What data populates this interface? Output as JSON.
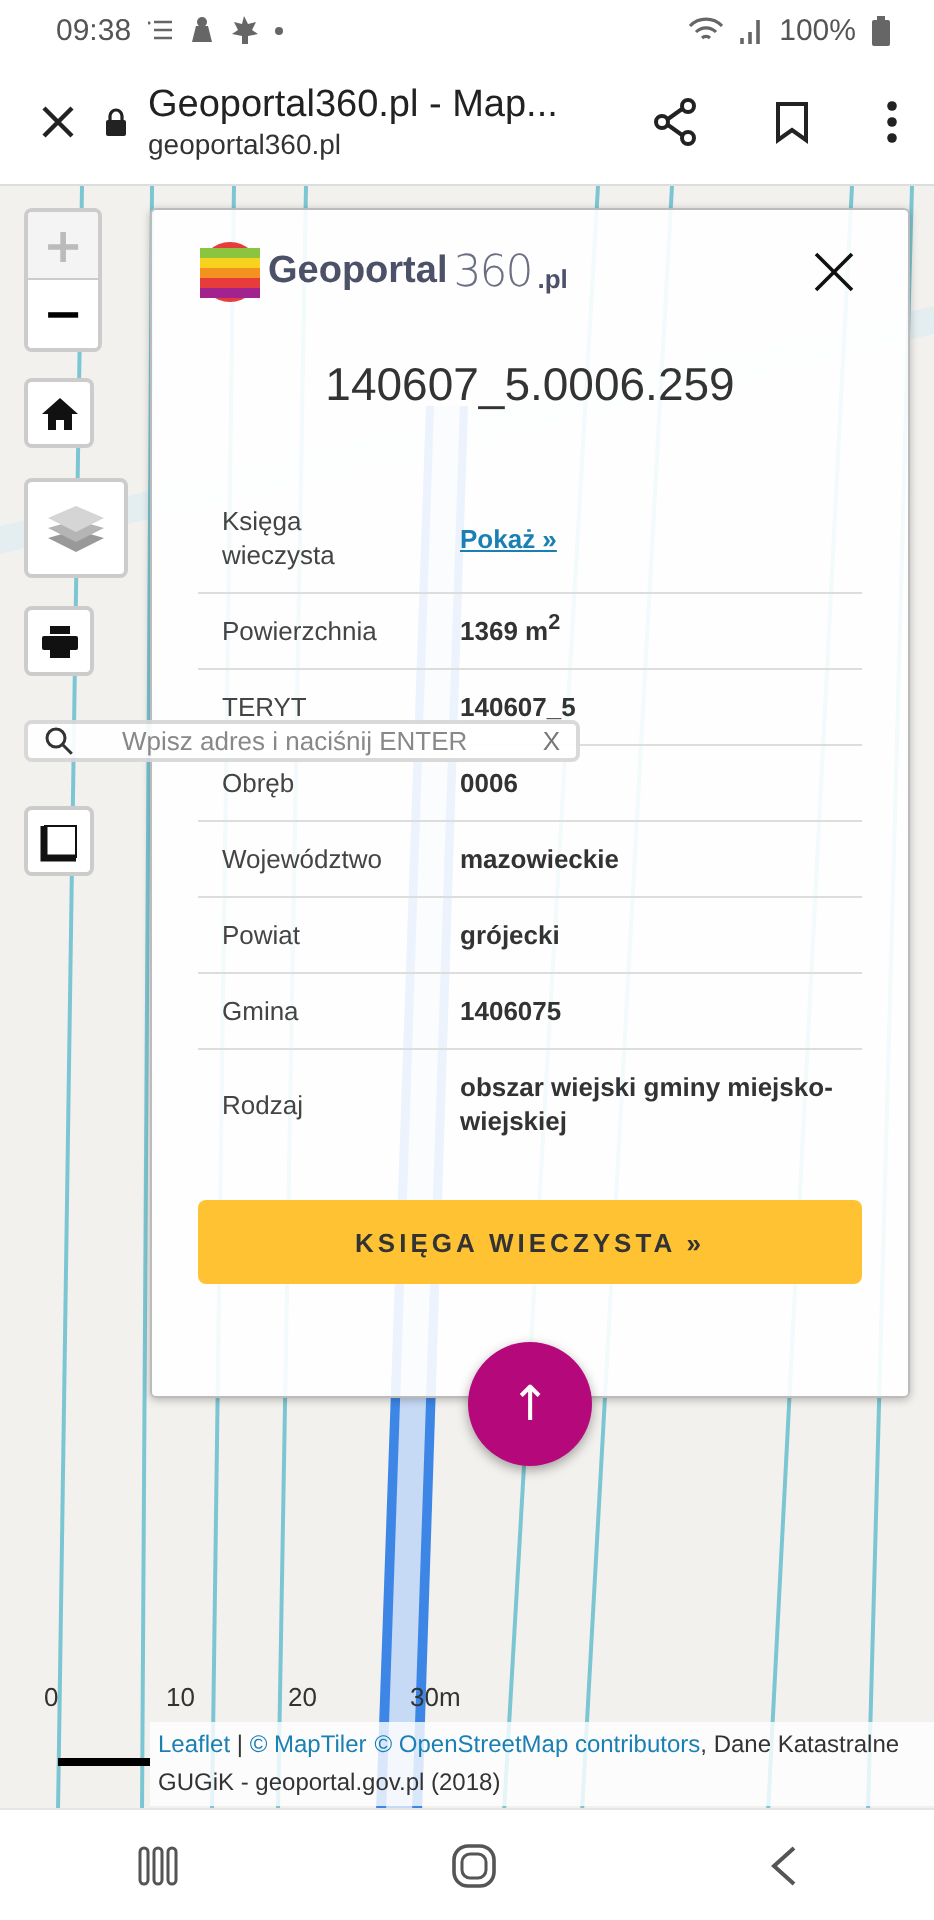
{
  "status_bar": {
    "time": "09:38",
    "battery": "100%"
  },
  "browser": {
    "title": "Geoportal360.pl - Map...",
    "url": "geoportal360.pl"
  },
  "map": {
    "zoom_in": {
      "label": "+",
      "disabled": true
    },
    "zoom_out": {
      "label": "−",
      "disabled": false
    },
    "search": {
      "placeholder": "Wpisz adres i naciśnij ENTER",
      "clear": "X"
    },
    "scale": [
      "0",
      "10",
      "20",
      "30m"
    ],
    "attribution": [
      {
        "kind": "link",
        "text": "Leaflet"
      },
      {
        "kind": "text",
        "text": " | "
      },
      {
        "kind": "link",
        "text": "© MapTiler"
      },
      {
        "kind": "link",
        "text": "© OpenStreetMap contributors"
      },
      {
        "kind": "text",
        "text": ", Dane Katastralne GUGiK - geoportal.gov.pl (2018)"
      }
    ]
  },
  "popup": {
    "logo": {
      "name": "Geoportal",
      "number": "360",
      "suffix": ".pl"
    },
    "title": "140607_5.0006.259",
    "rows": [
      {
        "label": "Księga wieczysta",
        "value": "Pokaż »",
        "kind": "link"
      },
      {
        "label": "Powierzchnia",
        "value": "1369 m$^{2}$",
        "kind": "text"
      },
      {
        "label": "TERYT",
        "value": "140607_5",
        "kind": "text"
      },
      {
        "label": "Obręb",
        "value": "0006",
        "kind": "text"
      },
      {
        "label": "Województwo",
        "value": "mazowieckie",
        "kind": "text"
      },
      {
        "label": "Powiat",
        "value": "grójecki",
        "kind": "text"
      },
      {
        "label": "Gmina",
        "value": "1406075",
        "kind": "text"
      },
      {
        "label": "Rodzaj",
        "value": "obszar wiejski gminy miejsko-wiejskiej",
        "kind": "text"
      }
    ],
    "button": "KSIĘGA WIECZYSTA »"
  },
  "fab": "↑"
}
